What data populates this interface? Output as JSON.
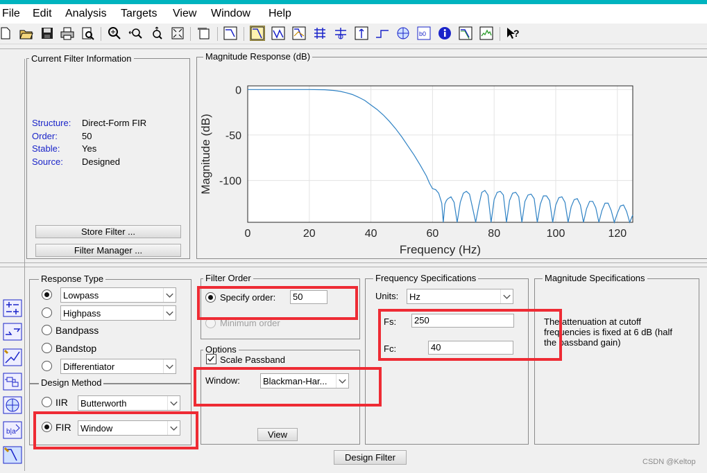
{
  "menu": [
    "File",
    "Edit",
    "Analysis",
    "Targets",
    "View",
    "Window",
    "Help"
  ],
  "toolbar_icons": [
    "new-icon",
    "open-icon",
    "save-icon",
    "print-icon",
    "print-preview-icon",
    "zoom-in-icon",
    "zoom-x-icon",
    "zoom-y-icon",
    "full-view-icon",
    "new-window-icon",
    "filter-spec-icon",
    "magnitude-response-icon",
    "phase-response-icon",
    "magnitude-phase-icon",
    "group-delay-icon",
    "phase-delay-icon",
    "impulse-response-icon",
    "step-response-icon",
    "pole-zero-icon",
    "coefficients-icon",
    "filter-info-icon",
    "magnitude-estimate-icon",
    "roundoff-noise-icon",
    "whats-this-icon"
  ],
  "info": {
    "title": "Current Filter Information",
    "rows": [
      {
        "key": "Structure:",
        "value": "Direct-Form FIR"
      },
      {
        "key": "Order:",
        "value": "50"
      },
      {
        "key": "Stable:",
        "value": "Yes"
      },
      {
        "key": "Source:",
        "value": "Designed"
      }
    ],
    "store_button": "Store Filter ...",
    "manager_button": "Filter Manager ..."
  },
  "plot_panel": {
    "title": "Magnitude Response (dB)"
  },
  "chart_data": {
    "type": "line",
    "xlabel": "Frequency (Hz)",
    "ylabel": "Magnitude (dB)",
    "xlim": [
      0,
      125
    ],
    "ylim": [
      -146,
      4
    ],
    "xticks": [
      0,
      20,
      40,
      60,
      80,
      100,
      120
    ],
    "yticks": [
      0,
      -50,
      -100
    ],
    "grid": true,
    "series": [
      {
        "color": "#2f82c4",
        "x": [
          0,
          10,
          20,
          25,
          28,
          30,
          32,
          34,
          36,
          38,
          40,
          42,
          44,
          46,
          48,
          50,
          52,
          54,
          56,
          58,
          59,
          60,
          61,
          62,
          63,
          63.5,
          64,
          64.5,
          65,
          66,
          67,
          68,
          69,
          70,
          71,
          72,
          73,
          74,
          75,
          76,
          77,
          78,
          79,
          80,
          81,
          82,
          83,
          84,
          85,
          86,
          87,
          88,
          89,
          90,
          91,
          92,
          93,
          94,
          95,
          96,
          97,
          98,
          99,
          100,
          101,
          102,
          103,
          104,
          105,
          106,
          107,
          108,
          109,
          110,
          111,
          112,
          113,
          114,
          115,
          116,
          117,
          118,
          119,
          120,
          121,
          122,
          123,
          124,
          125
        ],
        "y": [
          0,
          0,
          0,
          -0.3,
          -1,
          -2,
          -3.5,
          -5.5,
          -8.5,
          -12,
          -17,
          -22,
          -28,
          -35,
          -43,
          -52,
          -62,
          -72,
          -83,
          -95,
          -103,
          -109,
          -110,
          -114,
          -125,
          -146,
          -126,
          -122,
          -120,
          -118,
          -124,
          -146,
          -124,
          -114,
          -112,
          -115,
          -130,
          -146,
          -128,
          -113,
          -111,
          -116,
          -146,
          -121,
          -113,
          -112,
          -116,
          -146,
          -122,
          -114,
          -113,
          -118,
          -146,
          -123,
          -116,
          -115,
          -120,
          -146,
          -126,
          -117,
          -117,
          -122,
          -146,
          -127,
          -119,
          -118,
          -124,
          -146,
          -129,
          -121,
          -120,
          -127,
          -146,
          -131,
          -123,
          -123,
          -130,
          -146,
          -133,
          -125,
          -125,
          -133,
          -146,
          -136,
          -128,
          -127,
          -134,
          -146,
          -138
        ]
      }
    ]
  },
  "response_type": {
    "title": "Response Type",
    "options": [
      {
        "label": "Lowpass",
        "kind": "combo",
        "selected": true
      },
      {
        "label": "Highpass",
        "kind": "combo",
        "selected": false
      },
      {
        "label": "Bandpass",
        "kind": "text",
        "selected": false
      },
      {
        "label": "Bandstop",
        "kind": "text",
        "selected": false
      },
      {
        "label": "Differentiator",
        "kind": "combo",
        "selected": false
      }
    ]
  },
  "design_method": {
    "title": "Design Method",
    "iir_label": "IIR",
    "iir_value": "Butterworth",
    "fir_label": "FIR",
    "fir_value": "Window",
    "selected": "FIR"
  },
  "filter_order": {
    "title": "Filter Order",
    "specify_label": "Specify order:",
    "order_value": "50",
    "minimum_label": "Minimum order"
  },
  "options": {
    "title": "Options",
    "scale_passband": "Scale Passband",
    "scale_checked": true,
    "window_label": "Window:",
    "window_value": "Blackman-Har...",
    "view_button": "View"
  },
  "freq_spec": {
    "title": "Frequency Specifications",
    "units_label": "Units:",
    "units_value": "Hz",
    "fs_label": "Fs:",
    "fs_value": "250",
    "fc_label": "Fc:",
    "fc_value": "40"
  },
  "mag_spec": {
    "title": "Magnitude Specifications",
    "text_lines": [
      "The attenuation at cutoff",
      "frequencies is fixed at 6 dB (half",
      "the passband gain)"
    ]
  },
  "design_button": "Design Filter",
  "watermark": "CSDN @Keltop",
  "colors": {
    "accent_strip": "#00b4bf",
    "highlight_box": "#ee2b34",
    "info_key": "#1a24c9",
    "plot_line": "#2f82c4"
  }
}
